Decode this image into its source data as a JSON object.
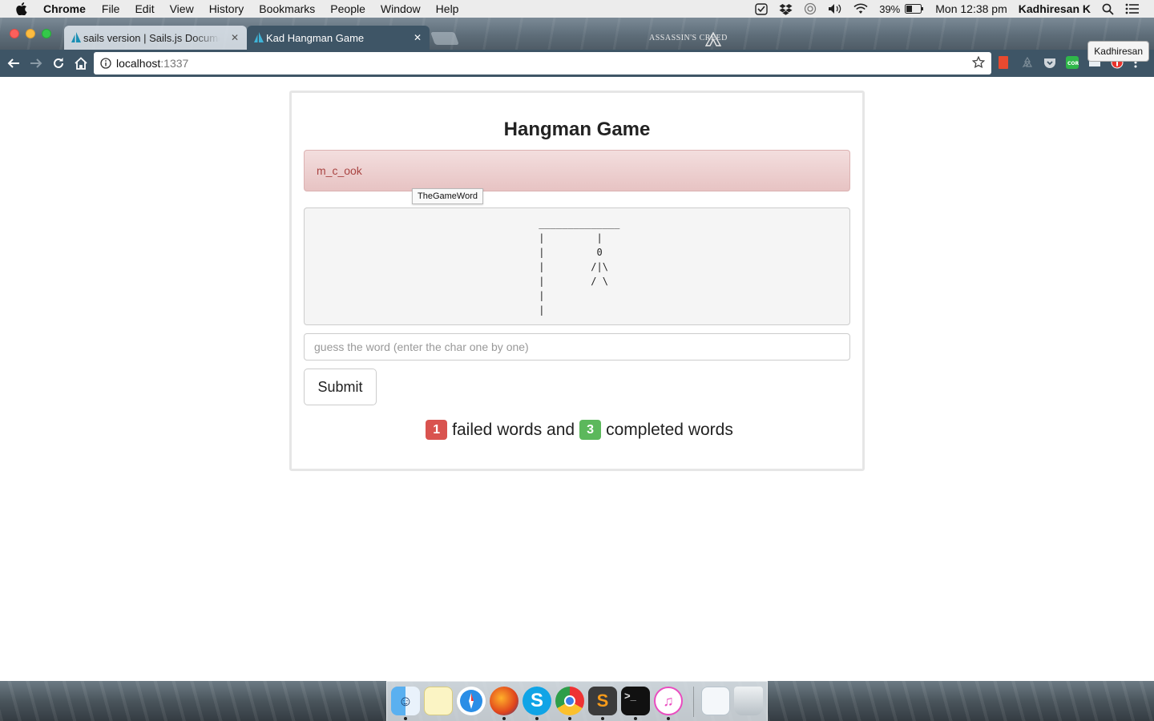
{
  "menubar": {
    "app": "Chrome",
    "items": [
      "File",
      "Edit",
      "View",
      "History",
      "Bookmarks",
      "People",
      "Window",
      "Help"
    ],
    "battery": "39%",
    "clock": "Mon 12:38 pm",
    "user": "Kadhiresan K"
  },
  "browser": {
    "tabs": [
      {
        "title": "sails version | Sails.js Docume"
      },
      {
        "title": "Kad Hangman Game"
      }
    ],
    "close_glyph": "✕",
    "profile": "Kadhiresan",
    "url_host": "localhost",
    "url_port": ":1337",
    "brand_text": "ASSASSIN'S CREED"
  },
  "page": {
    "title": "Hangman Game",
    "word": "m_c_ook",
    "tooltip": "TheGameWord",
    "gallows_art": " ______________\n |         |\n |         0\n |        /|\\\n |        / \\\n |\n |",
    "input_placeholder": "guess the word (enter the char one by one)",
    "submit_label": "Submit",
    "failed_count": "1",
    "failed_text": "failed words and",
    "completed_count": "3",
    "completed_text": "completed words"
  },
  "colors": {
    "alert_text": "#a94442",
    "badge_failed": "#d9534f",
    "badge_completed": "#5cb85c",
    "tab_active": "#3e5566"
  },
  "dock": {
    "apps": [
      "finder-icon",
      "notes-icon",
      "safari-icon",
      "firefox-icon",
      "skype-icon",
      "chrome-icon",
      "sublime-icon",
      "terminal-icon",
      "itunes-icon",
      "document-icon",
      "trash-icon"
    ]
  }
}
